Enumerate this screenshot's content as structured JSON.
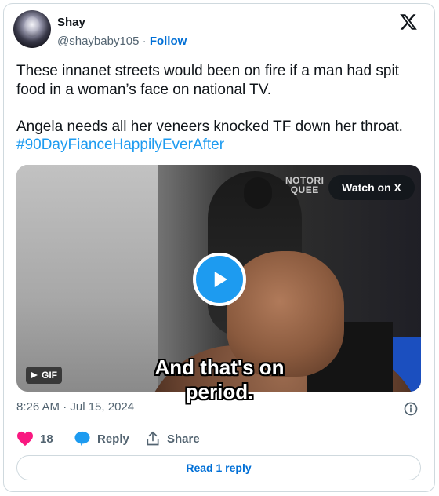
{
  "author": {
    "name": "Shay",
    "handle": "@shaybaby105",
    "separator": "·",
    "follow_label": "Follow"
  },
  "tweet": {
    "line1": "These innanet streets would been on fire if a man had spit",
    "line2": "food in a woman’s face on national TV.",
    "line3": "Angela needs all her veneers knocked TF down her throat.",
    "hashtag": "#90DayFianceHappilyEverAfter"
  },
  "media": {
    "watch_label": "Watch on X",
    "caption": "And that's on period.",
    "gif_label": "GIF",
    "watermark_line1": "NOTORI",
    "watermark_line2": "QUEE"
  },
  "meta": {
    "timestamp": "8:26 AM · Jul 15, 2024"
  },
  "actions": {
    "like_count": "18",
    "reply_label": "Reply",
    "share_label": "Share"
  },
  "footer": {
    "read_reply_label": "Read 1 reply"
  },
  "colors": {
    "like": "#f91880",
    "link": "#006fd6",
    "hashtag": "#1d9bf0",
    "play": "#1d9bf0"
  }
}
